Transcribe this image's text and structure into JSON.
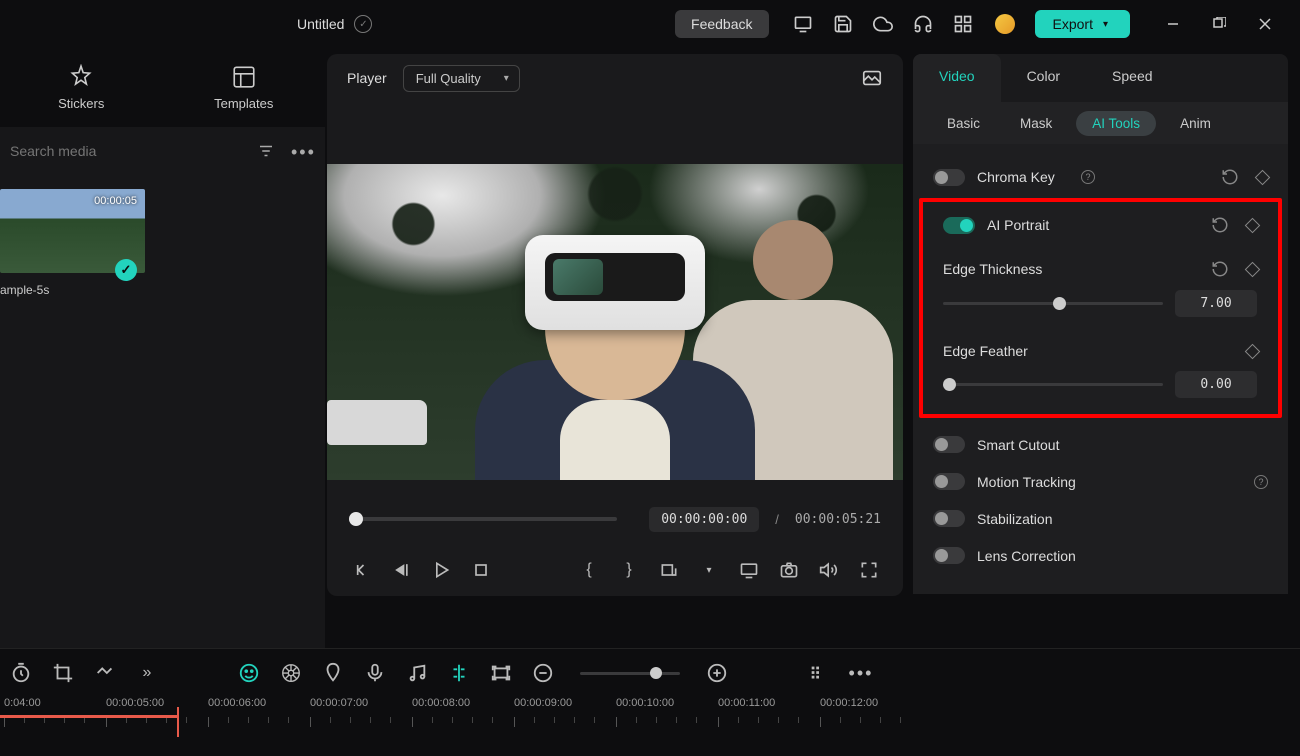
{
  "title": "Untitled",
  "topbar": {
    "feedback": "Feedback",
    "export": "Export"
  },
  "leftPanel": {
    "tabs": {
      "stickers": "Stickers",
      "templates": "Templates"
    },
    "searchPlaceholder": "Search media",
    "clip": {
      "duration": "00:00:05",
      "name": "ample-5s"
    }
  },
  "preview": {
    "label": "Player",
    "quality": "Full Quality",
    "currentTime": "00:00:00:00",
    "sep": "/",
    "duration": "00:00:05:21"
  },
  "rightPanel": {
    "tabs": {
      "video": "Video",
      "color": "Color",
      "speed": "Speed"
    },
    "subtabs": {
      "basic": "Basic",
      "mask": "Mask",
      "aiTools": "AI Tools",
      "anim": "Anim"
    },
    "props": {
      "chromaKey": "Chroma Key",
      "aiPortrait": "AI Portrait",
      "edgeThickness": {
        "label": "Edge Thickness",
        "value": "7.00"
      },
      "edgeFeather": {
        "label": "Edge Feather",
        "value": "0.00"
      },
      "smartCutout": "Smart Cutout",
      "motionTracking": "Motion Tracking",
      "stabilization": "Stabilization",
      "lensCorrection": "Lens Correction"
    }
  },
  "timeline": {
    "marks": [
      "0:04:00",
      "00:00:05:00",
      "00:00:06:00",
      "00:00:07:00",
      "00:00:08:00",
      "00:00:09:00",
      "00:00:10:00",
      "00:00:11:00",
      "00:00:12:00"
    ]
  }
}
